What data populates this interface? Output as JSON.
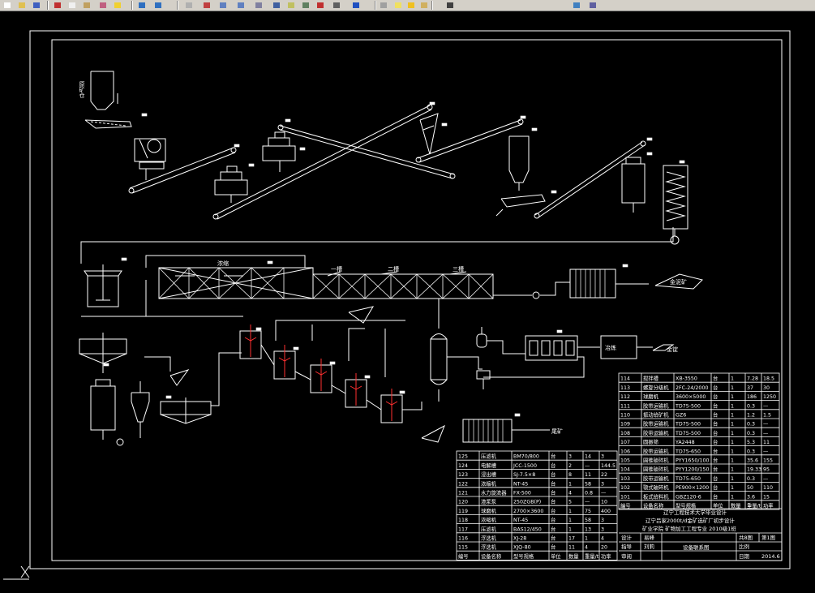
{
  "toolbar": {
    "buttons": [
      "new-icon",
      "open-icon",
      "save-icon",
      "cut-icon",
      "copy-icon",
      "paste-icon",
      "brush-icon",
      "pencil-icon",
      "undo-icon",
      "redo-icon",
      "pan-icon",
      "zoom-realtime-icon",
      "zoom-window-icon",
      "zoom-previous-icon",
      "properties-icon",
      "designcenter-icon",
      "toolpalette-icon",
      "sheetset-icon",
      "markup-icon",
      "calculator-icon",
      "help-icon",
      "layer-manager-icon",
      "lightbulb-icon",
      "sun-icon",
      "lock-icon",
      "color-icon",
      "layer-state-icon",
      "layer-previous-icon"
    ],
    "layer_value": "0"
  },
  "drawing": {
    "labels": {
      "raw_ore_bin": "原矿仓",
      "thickening": "浓缩",
      "stage1": "一槽",
      "stage2": "二槽",
      "stage3": "三槽",
      "gold_mud": "金泥矿",
      "smelting": "冶炼",
      "gold_ingot": "金锭",
      "tailings": "尾矿"
    },
    "part_tag": "10"
  },
  "table_right": {
    "rows": [
      [
        "114",
        "搅拌槽",
        "XB-3550",
        "台",
        "1",
        "7.28",
        "18.5"
      ],
      [
        "113",
        "螺旋分级机",
        "2FC-24/2000",
        "台",
        "1",
        "37",
        "30"
      ],
      [
        "112",
        "球磨机",
        "3600×5000",
        "台",
        "1",
        "186",
        "1250"
      ],
      [
        "111",
        "胶带运输机",
        "TD75-500",
        "台",
        "1",
        "0.3",
        "—"
      ],
      [
        "110",
        "振动给矿机",
        "GZ6",
        "台",
        "1",
        "1.2",
        "1.5"
      ],
      [
        "109",
        "胶带运输机",
        "TD75-500",
        "台",
        "1",
        "0.3",
        "—"
      ],
      [
        "108",
        "胶带运输机",
        "TD75-500",
        "台",
        "1",
        "0.3",
        "—"
      ],
      [
        "107",
        "圆振筛",
        "YA2448",
        "台",
        "1",
        "5.3",
        "11"
      ],
      [
        "106",
        "胶带运输机",
        "TD75-650",
        "台",
        "1",
        "0.3",
        "—"
      ],
      [
        "105",
        "圆锥破碎机",
        "PYY1650/100",
        "台",
        "1",
        "35.6",
        "155"
      ],
      [
        "104",
        "圆锥破碎机",
        "PYY1200/150",
        "台",
        "1",
        "19.33",
        "95"
      ],
      [
        "103",
        "胶带运输机",
        "TD75-650",
        "台",
        "1",
        "0.3",
        "—"
      ],
      [
        "102",
        "颚式破碎机",
        "PE900×1200",
        "台",
        "1",
        "50",
        "110"
      ],
      [
        "101",
        "板式给料机",
        "GBZ120-6",
        "台",
        "1",
        "3.6",
        "15"
      ]
    ],
    "header": [
      "编号",
      "设备名称",
      "型号规格",
      "单位",
      "数量",
      "重量/t",
      "功率"
    ]
  },
  "table_left": {
    "rows": [
      [
        "125",
        "压滤机",
        "BM70/800",
        "台",
        "3",
        "14",
        "3"
      ],
      [
        "124",
        "电解槽",
        "JCC-1500",
        "台",
        "2",
        "—",
        "144.5"
      ],
      [
        "123",
        "浸出槽",
        "SJ-7.5×8",
        "台",
        "8",
        "11",
        "22"
      ],
      [
        "122",
        "浓缩机",
        "NT-45",
        "台",
        "1",
        "58",
        "3"
      ],
      [
        "121",
        "水力旋流器",
        "FX-500",
        "台",
        "4",
        "0.8",
        "—"
      ],
      [
        "120",
        "渣浆泵",
        "250ZGB(P)",
        "台",
        "5",
        "—",
        "10"
      ],
      [
        "119",
        "球磨机",
        "2700×3600",
        "台",
        "1",
        "75",
        "400"
      ],
      [
        "118",
        "浓缩机",
        "NT-45",
        "台",
        "1",
        "58",
        "3"
      ],
      [
        "117",
        "压滤机",
        "BAS12/450",
        "台",
        "1",
        "13",
        "3"
      ],
      [
        "116",
        "浮选机",
        "XJ-28",
        "台",
        "17",
        "1",
        "4"
      ],
      [
        "115",
        "浮选机",
        "XJQ-80",
        "台",
        "11",
        "4",
        "20"
      ]
    ],
    "header": [
      "编号",
      "设备名称",
      "型号规格",
      "单位",
      "数量",
      "重量/t",
      "功率"
    ]
  },
  "title_block": {
    "school": "辽宁工程技术大学毕业设计",
    "project": "辽宁吕家2000t/d金矿选矿厂初步设计",
    "major": "矿业学院 矿物加工工程专业 2010级1班",
    "design_label": "设计",
    "design_name": "易峰",
    "review_label": "指导",
    "review_name": "刘莉",
    "approve_label": "审阅",
    "drawing_name": "设备联系图",
    "sheets": "共8图",
    "sheet_no": "第1图",
    "scale_label": "比例",
    "date_label": "日期",
    "date": "2014.6"
  }
}
